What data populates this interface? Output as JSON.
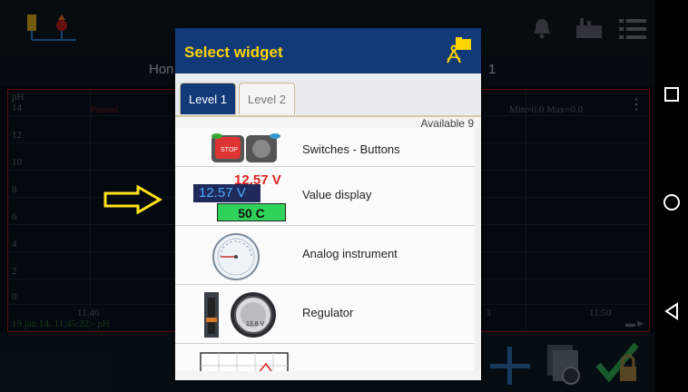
{
  "background": {
    "tab_left": "Hon",
    "tab_right": "1",
    "chart": {
      "y_unit": "pH",
      "y_ticks": [
        "14",
        "12",
        "10",
        "8",
        "6",
        "4",
        "2",
        "0"
      ],
      "status": "Paused",
      "minmax": "Min=0.0 Max=0.0",
      "x_start": "11:46",
      "x_end": "11:50",
      "x_mid": "3",
      "legend": "19 jan 14. 11:45:22 - pH"
    }
  },
  "dialog": {
    "title": "Select widget",
    "tabs": [
      {
        "label": "Level 1",
        "active": true
      },
      {
        "label": "Level 2",
        "active": false
      }
    ],
    "available": "Available 9",
    "items": [
      {
        "label": "Switches - Buttons",
        "icon": "switch-buttons-icon"
      },
      {
        "label": "Value display",
        "icon": "value-display-icon",
        "preview": {
          "red": "12.57 V",
          "blue": "12.57 V",
          "green": "50 C"
        }
      },
      {
        "label": "Analog instrument",
        "icon": "analog-gauge-icon"
      },
      {
        "label": "Regulator",
        "icon": "regulator-icon",
        "knob_text": "13.8 V"
      },
      {
        "label": "",
        "icon": "graph-icon"
      }
    ]
  },
  "colors": {
    "dialog_header": "#123a78",
    "title_yellow": "#ffd400",
    "chart_border": "#b01515",
    "arrow_yellow": "#ffe21a"
  }
}
